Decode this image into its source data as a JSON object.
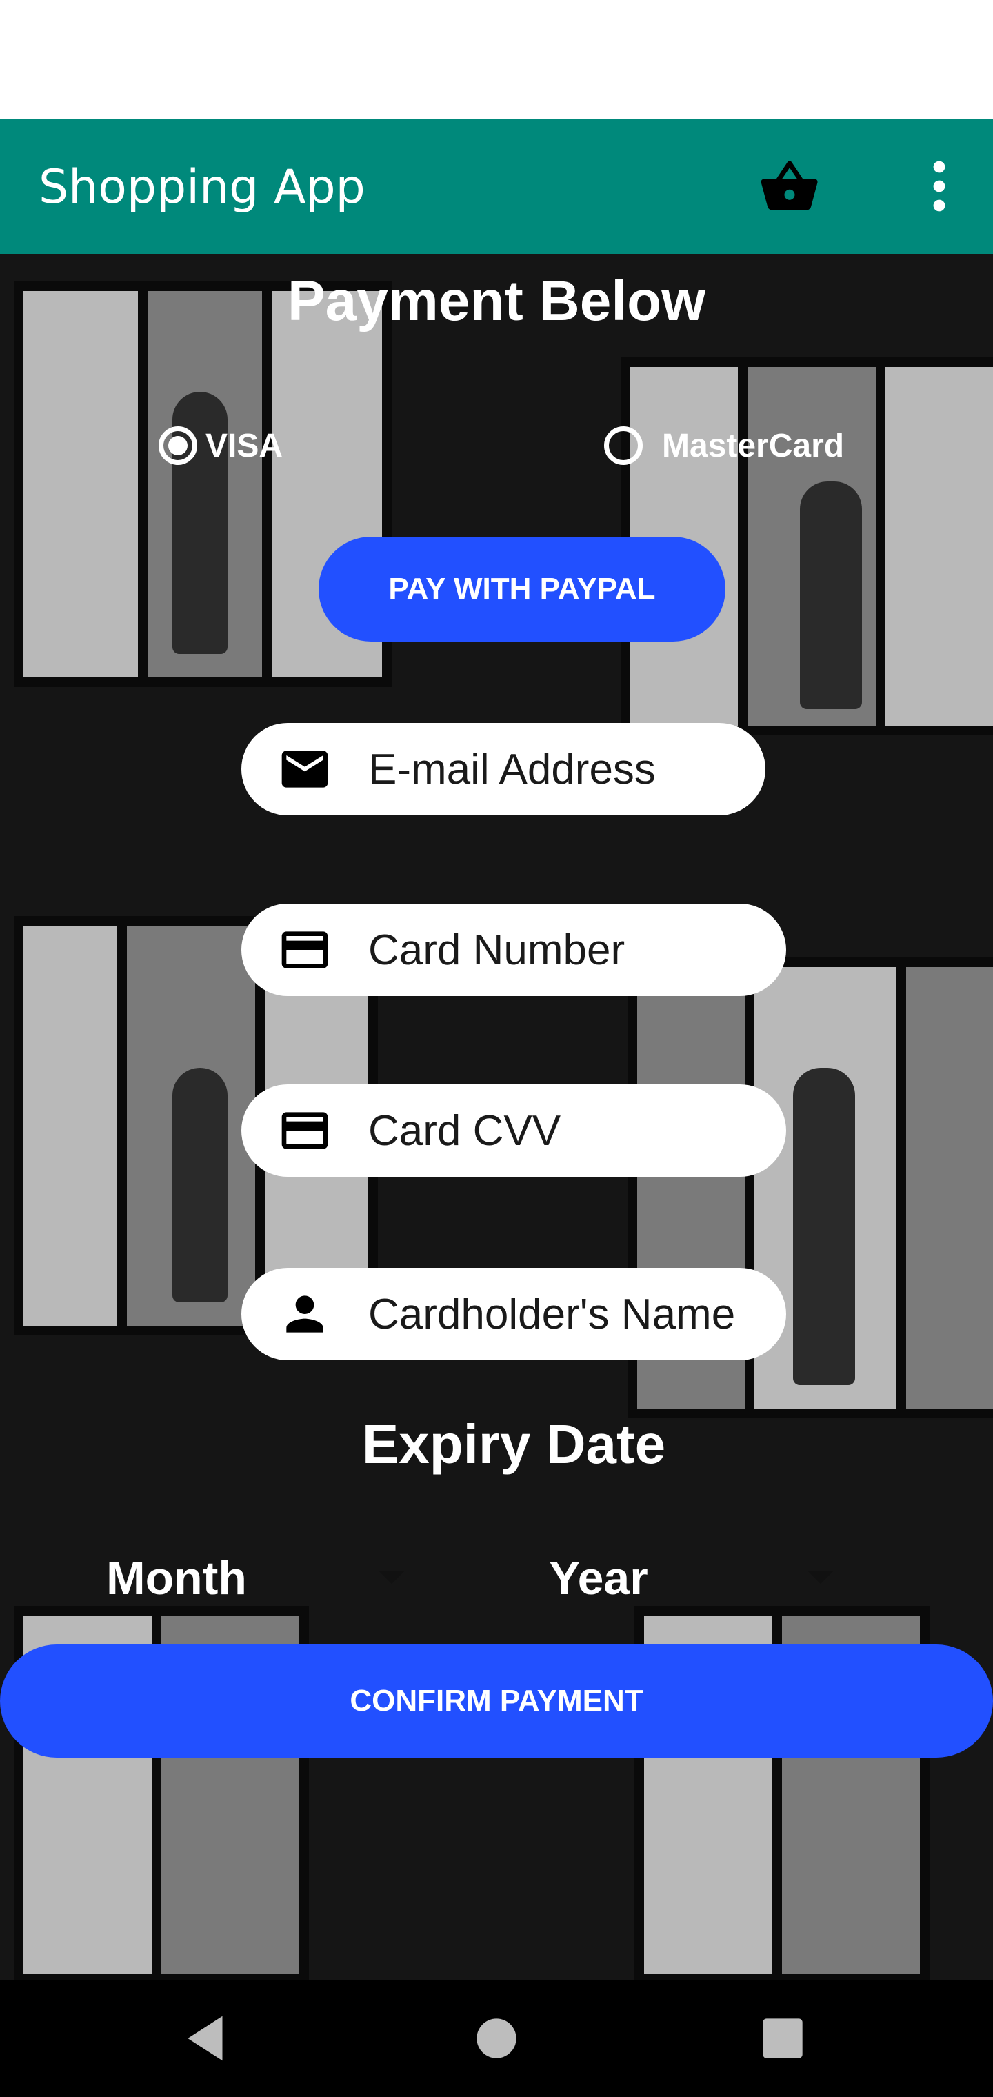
{
  "app_bar": {
    "title": "Shopping App",
    "background": "#00897b",
    "cart_icon": "basket-icon",
    "menu_icon": "more-vert-icon"
  },
  "main": {
    "title": "Payment Below",
    "card_types": [
      {
        "label": "VISA",
        "selected": true
      },
      {
        "label": "MasterCard",
        "selected": false
      }
    ],
    "paypal_label": "PAY WITH PAYPAL",
    "fields": {
      "email": {
        "placeholder": "E-mail Address",
        "icon": "mail-icon"
      },
      "card_number": {
        "placeholder": "Card Number",
        "icon": "credit-card-icon"
      },
      "card_cvv": {
        "placeholder": "Card CVV",
        "icon": "credit-card-icon"
      },
      "cardholder": {
        "placeholder": "Cardholder's Name",
        "icon": "person-icon"
      }
    },
    "expiry_title": "Expiry Date",
    "month_label": "Month",
    "year_label": "Year",
    "confirm_label": "CONFIRM PAYMENT",
    "accent": "#2250ff"
  },
  "nav": {
    "back_icon": "back-triangle-icon",
    "home_icon": "home-circle-icon",
    "recents_icon": "recents-square-icon"
  }
}
